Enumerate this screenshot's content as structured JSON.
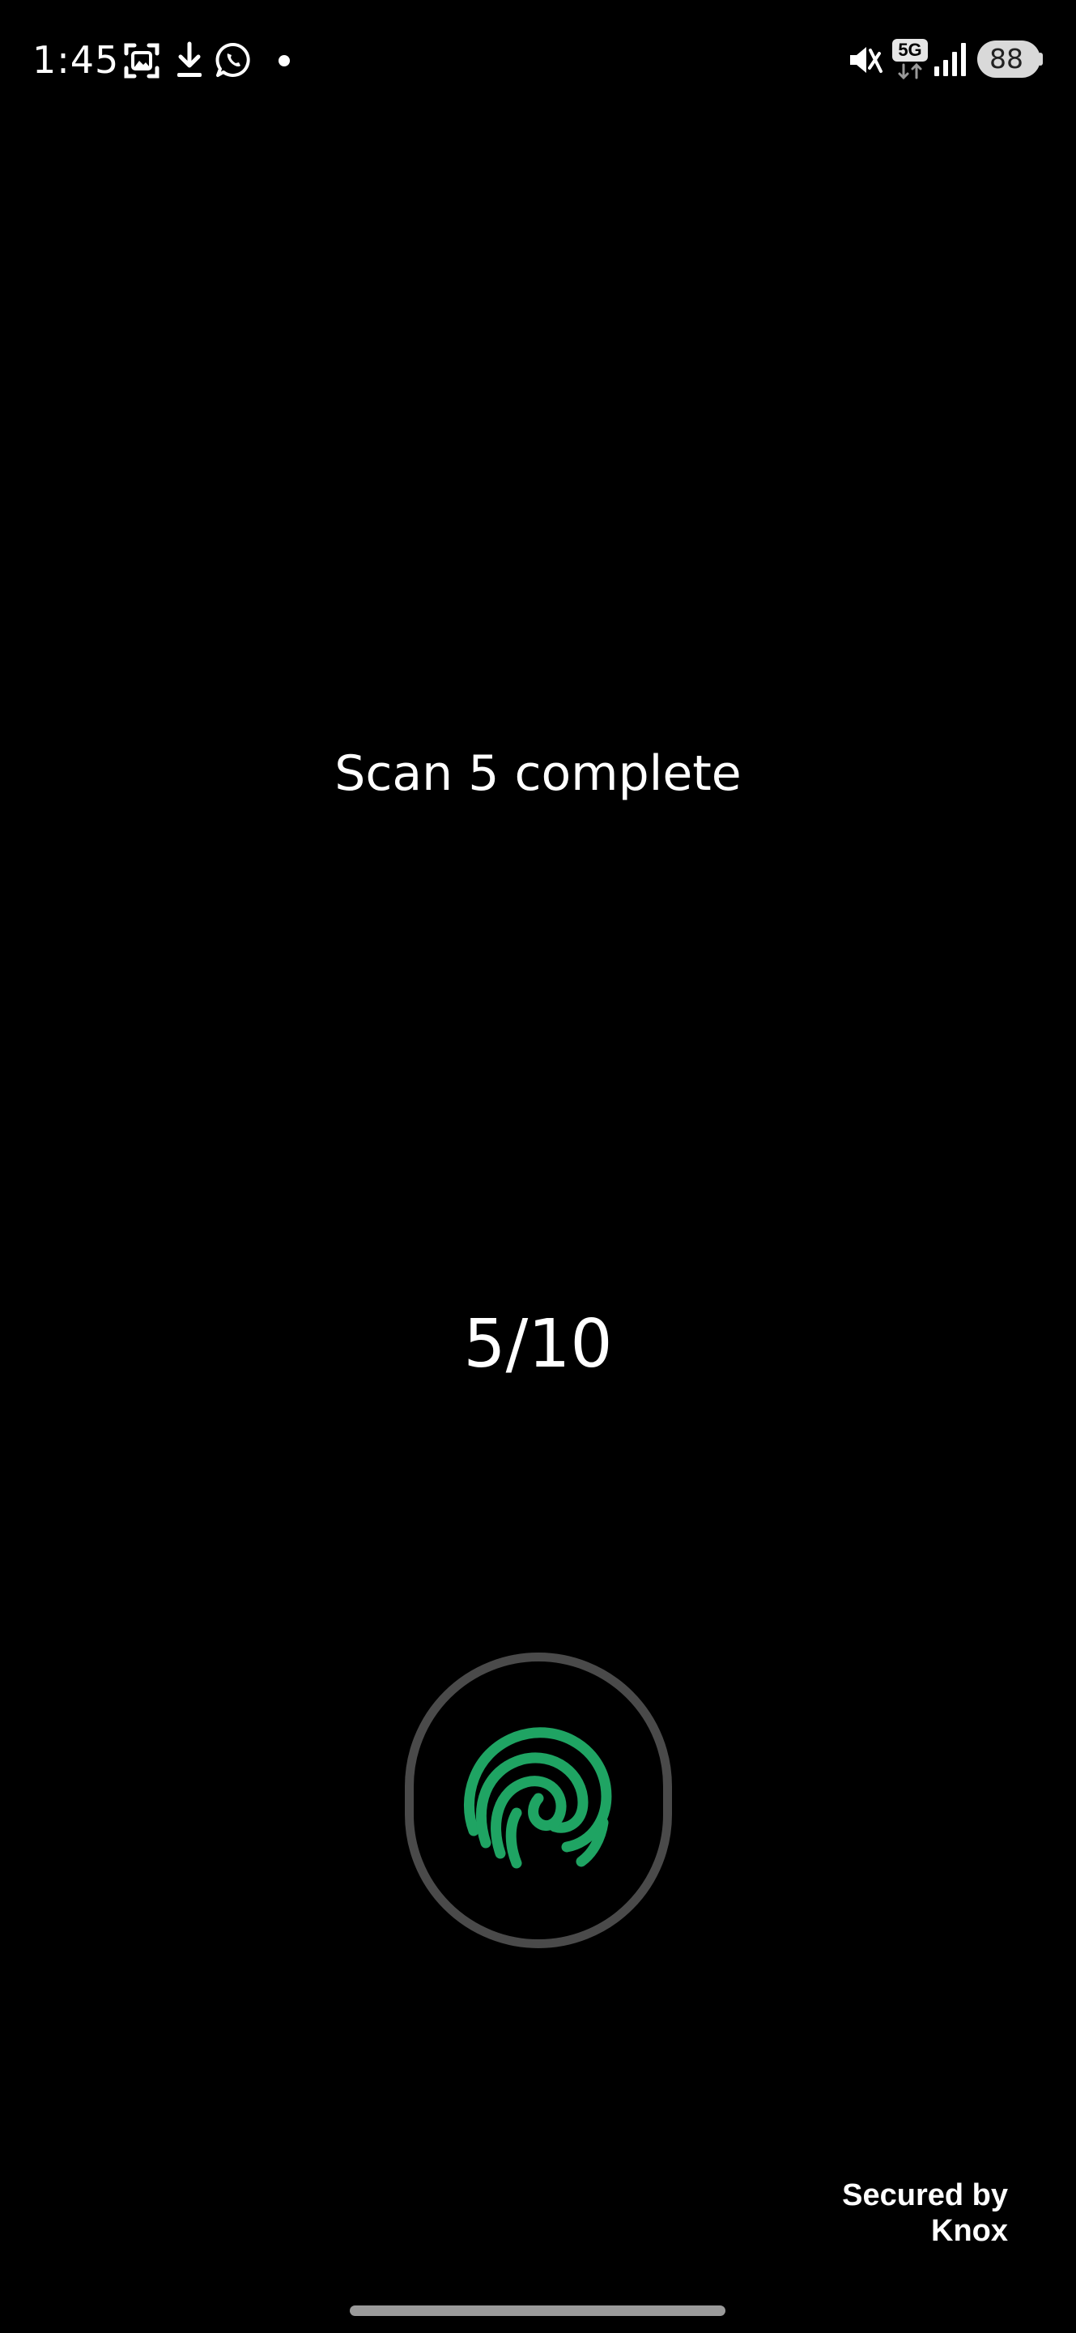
{
  "status_bar": {
    "time": "1:45",
    "battery_level": "88",
    "network_type": "5G",
    "left_icons": [
      "screenshot-icon",
      "download-icon",
      "whatsapp-icon",
      "notification-dot-icon"
    ],
    "right_icons": [
      "mute-icon",
      "5g-data-icon",
      "signal-icon",
      "battery-icon"
    ]
  },
  "enrollment": {
    "message": "Scan 5 complete",
    "progress_text": "5/10",
    "progress_fraction": 0.5,
    "fingerprint_color": "#1fa463"
  },
  "footer": {
    "secured_by": "Secured by",
    "brand": "Knox"
  }
}
